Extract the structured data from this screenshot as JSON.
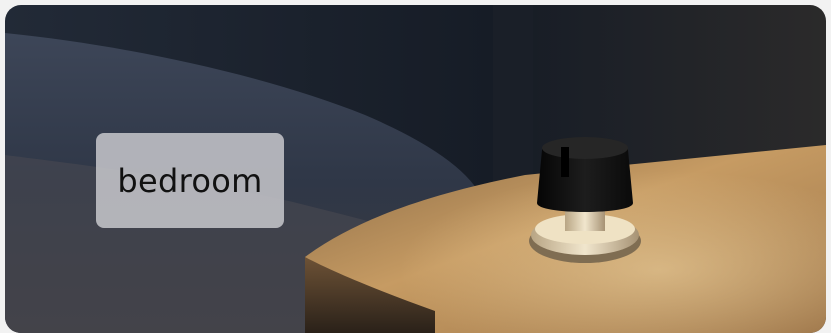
{
  "scene": {
    "room_label": "bedroom"
  },
  "colors": {
    "wall": "#1c2330",
    "bedding": "#3a4354",
    "nightstand_top": "#b58a55",
    "lamp_shade": "#111111",
    "lamp_base": "#d9c9a8"
  }
}
